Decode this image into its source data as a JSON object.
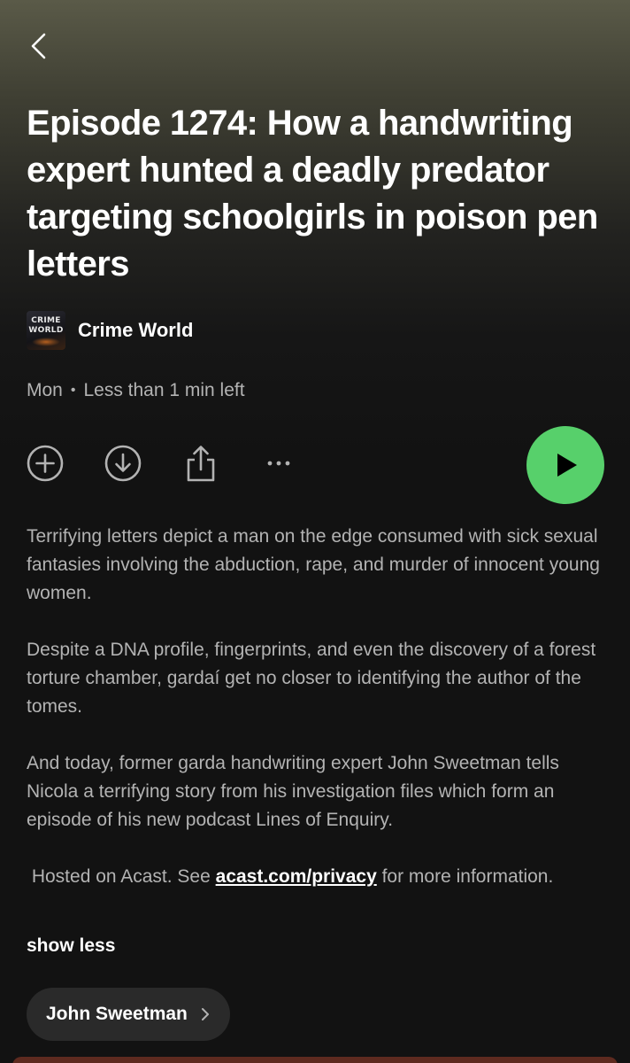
{
  "header": {
    "back_icon": "chevron-left-icon"
  },
  "episode": {
    "title": "Episode 1274: How a handwriting expert hunted a deadly predator targeting schoolgirls in poison pen letters",
    "day": "Mon",
    "separator": "•",
    "time_left": "Less than 1 min left"
  },
  "show": {
    "name": "Crime World",
    "art_text_line1": "CRIME",
    "art_text_line2": "WORLD"
  },
  "actions": {
    "add_icon": "plus-circle-icon",
    "download_icon": "download-circle-icon",
    "share_icon": "share-icon",
    "more_icon": "more-dots-icon",
    "play_icon": "play-icon"
  },
  "description": {
    "paragraph1": "Terrifying letters depict a man on the edge consumed with sick sexual fantasies involving the abduction, rape, and murder of innocent young women.",
    "paragraph2": "Despite a DNA profile, fingerprints, and even the discovery of a forest torture chamber, gardaí get no closer to identifying the author of the tomes.",
    "paragraph3": "And today, former garda handwriting expert John Sweetman tells Nicola a terrifying story from his investigation files which form an episode of his new podcast Lines of Enquiry.",
    "hosted_prefix": " Hosted on Acast. See ",
    "hosted_link": "acast.com/privacy",
    "hosted_suffix": " for more information.",
    "show_less_label": "show less"
  },
  "chips": {
    "person_label": "John Sweetman",
    "chevron_icon": "chevron-right-icon"
  },
  "colors": {
    "background": "#121212",
    "header_gradient_top": "#5a5a48",
    "play_button": "#57d06b",
    "secondary_text": "#b3b3b3",
    "chip_background": "#2a2a2a"
  }
}
